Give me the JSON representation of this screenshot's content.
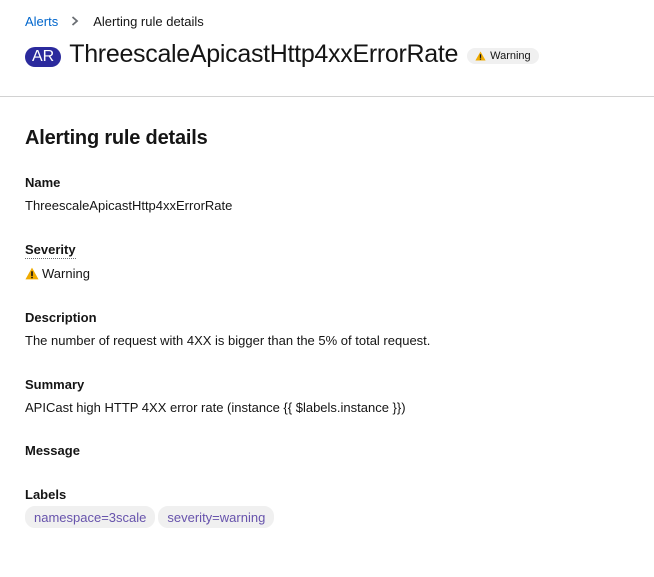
{
  "breadcrumb": {
    "parent": "Alerts",
    "current": "Alerting rule details"
  },
  "header": {
    "badge": "AR",
    "title": "ThreescaleApicastHttp4xxErrorRate",
    "severity_label": "Warning"
  },
  "section_title": "Alerting rule details",
  "details": {
    "name_term": "Name",
    "name_value": "ThreescaleApicastHttp4xxErrorRate",
    "severity_term": "Severity",
    "severity_value": "Warning",
    "description_term": "Description",
    "description_value": "The number of request with 4XX is bigger than the 5% of total request.",
    "summary_term": "Summary",
    "summary_value": "APICast high HTTP 4XX error rate (instance {{ $labels.instance }})",
    "message_term": "Message",
    "message_value": "",
    "labels_term": "Labels",
    "labels": [
      "namespace=3scale",
      "severity=warning"
    ]
  },
  "colors": {
    "link": "#0066cc",
    "badge_bg": "#2b2a9d",
    "warning": "#f0ab00",
    "label_text": "#6753ac"
  },
  "icons": {
    "separator": "chevron-right-icon",
    "warning": "warning-triangle-icon"
  }
}
